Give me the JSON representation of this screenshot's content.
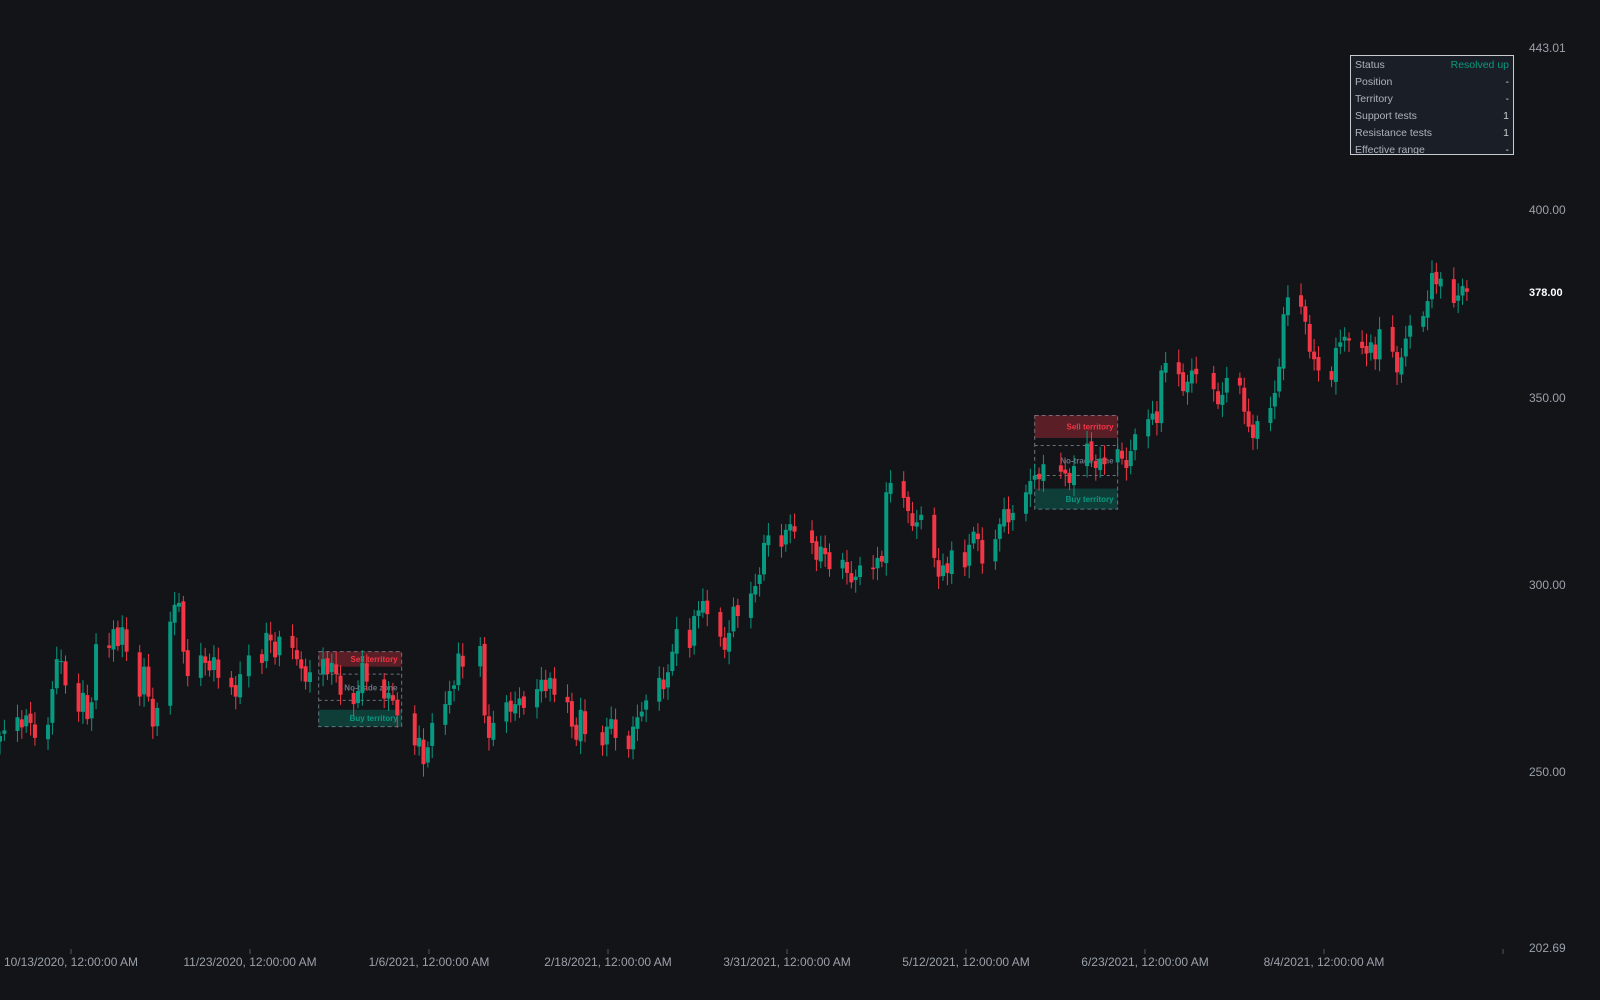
{
  "colors": {
    "background": "#131418",
    "up": "#089981",
    "down": "#f23645",
    "text": "#9aa0aa"
  },
  "price_axis": {
    "labels": [
      "443.01",
      "400.00",
      "378.00",
      "350.00",
      "300.00",
      "250.00",
      "202.69"
    ],
    "current": "378.00"
  },
  "time_axis": {
    "labels": [
      "10/13/2020, 12:00:00 AM",
      "11/23/2020, 12:00:00 AM",
      "1/6/2021, 12:00:00 AM",
      "2/18/2021, 12:00:00 AM",
      "3/31/2021, 12:00:00 AM",
      "5/12/2021, 12:00:00 AM",
      "6/23/2021, 12:00:00 AM",
      "8/4/2021, 12:00:00 AM"
    ]
  },
  "status_panel": {
    "rows": [
      {
        "label": "Status",
        "value": "Resolved up"
      },
      {
        "label": "Position",
        "value": "-"
      },
      {
        "label": "Territory",
        "value": "-"
      },
      {
        "label": "Support tests",
        "value": "1"
      },
      {
        "label": "Resistance tests",
        "value": "1"
      },
      {
        "label": "Effective range",
        "value": "-"
      }
    ]
  },
  "chart_data": {
    "type": "candlestick",
    "ylim": [
      202.69,
      443.01
    ],
    "xlim": [
      "2020-10-01",
      "2021-09-05"
    ],
    "last_price": 378.0,
    "zones": [
      {
        "x_start": "2020-12-13",
        "x_end": "2021-01-01",
        "sell_territory": [
          278.0,
          282.0
        ],
        "no_trade_zone": [
          269.0,
          276.0
        ],
        "buy_territory": [
          262.0,
          266.5
        ],
        "labels": {
          "sell": "Sell territory",
          "no_trade": "No-trade zone",
          "buy": "Buy territory"
        }
      },
      {
        "x_start": "2021-05-26",
        "x_end": "2021-06-14",
        "sell_territory": [
          339.0,
          345.0
        ],
        "no_trade_zone": [
          329.0,
          337.0
        ],
        "buy_territory": [
          320.0,
          325.5
        ],
        "labels": {
          "sell": "Sell territory",
          "no_trade": "No-trade zone",
          "buy": "Buy territory"
        }
      }
    ],
    "candles_daily_close": [
      [
        "2020-10-01",
        259.5
      ],
      [
        "2020-10-02",
        261.0
      ],
      [
        "2020-10-05",
        264.5
      ],
      [
        "2020-10-06",
        261.8
      ],
      [
        "2020-10-07",
        265.0
      ],
      [
        "2020-10-08",
        263.0
      ],
      [
        "2020-10-09",
        259.0
      ],
      [
        "2020-10-12",
        262.5
      ],
      [
        "2020-10-13",
        272.0
      ],
      [
        "2020-10-14",
        280.0
      ],
      [
        "2020-10-15",
        279.5
      ],
      [
        "2020-10-16",
        273.0
      ],
      [
        "2020-10-19",
        266.0
      ],
      [
        "2020-10-20",
        271.0
      ],
      [
        "2020-10-21",
        264.0
      ],
      [
        "2020-10-22",
        268.5
      ],
      [
        "2020-10-23",
        284.0
      ],
      [
        "2020-10-26",
        283.0
      ],
      [
        "2020-10-27",
        288.0
      ],
      [
        "2020-10-28",
        283.5
      ],
      [
        "2020-10-29",
        288.5
      ],
      [
        "2020-10-30",
        282.0
      ],
      [
        "2020-11-02",
        270.0
      ],
      [
        "2020-11-03",
        278.0
      ],
      [
        "2020-11-04",
        270.0
      ],
      [
        "2020-11-05",
        262.0
      ],
      [
        "2020-11-06",
        267.0
      ],
      [
        "2020-11-09",
        290.0
      ],
      [
        "2020-11-10",
        294.5
      ],
      [
        "2020-11-11",
        295.0
      ],
      [
        "2020-11-12",
        282.0
      ],
      [
        "2020-11-13",
        275.5
      ],
      [
        "2020-11-16",
        281.0
      ],
      [
        "2020-11-17",
        279.0
      ],
      [
        "2020-11-18",
        277.0
      ],
      [
        "2020-11-19",
        280.5
      ],
      [
        "2020-11-20",
        275.0
      ],
      [
        "2020-11-23",
        272.5
      ],
      [
        "2020-11-24",
        270.0
      ],
      [
        "2020-11-25",
        276.0
      ],
      [
        "2020-11-27",
        281.0
      ],
      [
        "2020-11-30",
        279.0
      ],
      [
        "2020-12-01",
        287.0
      ],
      [
        "2020-12-02",
        285.0
      ],
      [
        "2020-12-03",
        280.5
      ],
      [
        "2020-12-04",
        286.0
      ],
      [
        "2020-12-07",
        283.0
      ],
      [
        "2020-12-08",
        280.0
      ],
      [
        "2020-12-09",
        277.5
      ],
      [
        "2020-12-10",
        274.0
      ],
      [
        "2020-12-11",
        276.5
      ],
      [
        "2020-12-14",
        280.0
      ],
      [
        "2020-12-15",
        276.0
      ],
      [
        "2020-12-16",
        279.0
      ],
      [
        "2020-12-17",
        276.0
      ],
      [
        "2020-12-18",
        270.5
      ],
      [
        "2020-12-21",
        268.0
      ],
      [
        "2020-12-22",
        271.5
      ],
      [
        "2020-12-23",
        279.0
      ],
      [
        "2020-12-24",
        274.0
      ],
      [
        "2020-12-28",
        269.5
      ],
      [
        "2020-12-29",
        271.0
      ],
      [
        "2020-12-30",
        269.0
      ],
      [
        "2020-12-31",
        265.0
      ],
      [
        "2021-01-04",
        257.0
      ],
      [
        "2021-01-05",
        259.0
      ],
      [
        "2021-01-06",
        252.0
      ],
      [
        "2021-01-07",
        256.5
      ],
      [
        "2021-01-08",
        263.0
      ],
      [
        "2021-01-11",
        268.0
      ],
      [
        "2021-01-12",
        271.5
      ],
      [
        "2021-01-13",
        273.0
      ],
      [
        "2021-01-14",
        281.5
      ],
      [
        "2021-01-15",
        278.0
      ],
      [
        "2021-01-19",
        283.5
      ],
      [
        "2021-01-20",
        265.0
      ],
      [
        "2021-01-21",
        259.0
      ],
      [
        "2021-01-22",
        263.0
      ],
      [
        "2021-01-25",
        268.5
      ],
      [
        "2021-01-26",
        266.0
      ],
      [
        "2021-01-27",
        268.0
      ],
      [
        "2021-01-28",
        269.5
      ],
      [
        "2021-01-29",
        267.0
      ],
      [
        "2021-02-01",
        272.0
      ],
      [
        "2021-02-02",
        274.5
      ],
      [
        "2021-02-03",
        271.5
      ],
      [
        "2021-02-04",
        275.0
      ],
      [
        "2021-02-05",
        270.5
      ],
      [
        "2021-02-08",
        268.5
      ],
      [
        "2021-02-09",
        262.0
      ],
      [
        "2021-02-10",
        258.5
      ],
      [
        "2021-02-11",
        266.5
      ],
      [
        "2021-02-12",
        260.0
      ],
      [
        "2021-02-16",
        257.0
      ],
      [
        "2021-02-17",
        262.0
      ],
      [
        "2021-02-18",
        264.0
      ],
      [
        "2021-02-19",
        259.0
      ],
      [
        "2021-02-22",
        256.0
      ],
      [
        "2021-02-23",
        262.0
      ],
      [
        "2021-02-24",
        264.5
      ],
      [
        "2021-02-25",
        266.0
      ],
      [
        "2021-02-26",
        269.0
      ],
      [
        "2021-03-01",
        275.0
      ],
      [
        "2021-03-02",
        272.0
      ],
      [
        "2021-03-03",
        276.5
      ],
      [
        "2021-03-04",
        282.0
      ],
      [
        "2021-03-05",
        288.0
      ],
      [
        "2021-03-08",
        283.0
      ],
      [
        "2021-03-09",
        291.5
      ],
      [
        "2021-03-10",
        293.0
      ],
      [
        "2021-03-11",
        295.5
      ],
      [
        "2021-03-12",
        292.0
      ],
      [
        "2021-03-15",
        286.0
      ],
      [
        "2021-03-16",
        282.5
      ],
      [
        "2021-03-17",
        287.0
      ],
      [
        "2021-03-18",
        294.0
      ],
      [
        "2021-03-19",
        291.5
      ],
      [
        "2021-03-22",
        297.5
      ],
      [
        "2021-03-23",
        299.5
      ],
      [
        "2021-03-24",
        302.5
      ],
      [
        "2021-03-25",
        311.0
      ],
      [
        "2021-03-26",
        313.0
      ],
      [
        "2021-03-29",
        310.0
      ],
      [
        "2021-03-30",
        314.5
      ],
      [
        "2021-03-31",
        316.0
      ],
      [
        "2021-04-01",
        314.0
      ],
      [
        "2021-04-05",
        311.0
      ],
      [
        "2021-04-06",
        306.5
      ],
      [
        "2021-04-07",
        310.0
      ],
      [
        "2021-04-08",
        308.0
      ],
      [
        "2021-04-09",
        304.0
      ],
      [
        "2021-04-12",
        306.5
      ],
      [
        "2021-04-13",
        303.0
      ],
      [
        "2021-04-14",
        300.5
      ],
      [
        "2021-04-15",
        302.0
      ],
      [
        "2021-04-16",
        305.0
      ],
      [
        "2021-04-19",
        304.0
      ],
      [
        "2021-04-20",
        307.0
      ],
      [
        "2021-04-21",
        306.0
      ],
      [
        "2021-04-22",
        324.5
      ],
      [
        "2021-04-23",
        327.0
      ],
      [
        "2021-04-26",
        323.0
      ],
      [
        "2021-04-27",
        319.5
      ],
      [
        "2021-04-28",
        315.5
      ],
      [
        "2021-04-29",
        316.5
      ],
      [
        "2021-04-30",
        318.5
      ],
      [
        "2021-05-03",
        307.0
      ],
      [
        "2021-05-04",
        302.0
      ],
      [
        "2021-05-05",
        305.0
      ],
      [
        "2021-05-06",
        303.0
      ],
      [
        "2021-05-07",
        309.0
      ],
      [
        "2021-05-10",
        304.5
      ],
      [
        "2021-05-11",
        310.5
      ],
      [
        "2021-05-12",
        314.0
      ],
      [
        "2021-05-13",
        312.0
      ],
      [
        "2021-05-14",
        305.5
      ],
      [
        "2021-05-17",
        312.0
      ],
      [
        "2021-05-18",
        316.0
      ],
      [
        "2021-05-19",
        320.0
      ],
      [
        "2021-05-20",
        316.5
      ],
      [
        "2021-05-21",
        319.0
      ],
      [
        "2021-05-24",
        324.5
      ],
      [
        "2021-05-25",
        327.5
      ],
      [
        "2021-05-26",
        329.0
      ],
      [
        "2021-05-27",
        328.0
      ],
      [
        "2021-05-28",
        332.0
      ],
      [
        "2021-06-01",
        330.0
      ],
      [
        "2021-06-02",
        329.5
      ],
      [
        "2021-06-03",
        327.0
      ],
      [
        "2021-06-04",
        331.5
      ],
      [
        "2021-06-07",
        337.5
      ],
      [
        "2021-06-08",
        333.0
      ],
      [
        "2021-06-09",
        331.0
      ],
      [
        "2021-06-10",
        333.5
      ],
      [
        "2021-06-11",
        332.0
      ],
      [
        "2021-06-14",
        336.0
      ],
      [
        "2021-06-15",
        333.5
      ],
      [
        "2021-06-16",
        331.0
      ],
      [
        "2021-06-17",
        335.5
      ],
      [
        "2021-06-18",
        340.0
      ],
      [
        "2021-06-21",
        344.0
      ],
      [
        "2021-06-22",
        345.5
      ],
      [
        "2021-06-23",
        343.0
      ],
      [
        "2021-06-24",
        357.0
      ],
      [
        "2021-06-25",
        359.0
      ],
      [
        "2021-06-28",
        356.0
      ],
      [
        "2021-06-29",
        351.5
      ],
      [
        "2021-06-30",
        354.0
      ],
      [
        "2021-07-01",
        357.0
      ],
      [
        "2021-07-02",
        356.0
      ],
      [
        "2021-07-06",
        352.0
      ],
      [
        "2021-07-07",
        348.0
      ],
      [
        "2021-07-08",
        350.5
      ],
      [
        "2021-07-09",
        355.0
      ],
      [
        "2021-07-12",
        353.0
      ],
      [
        "2021-07-13",
        346.0
      ],
      [
        "2021-07-14",
        342.0
      ],
      [
        "2021-07-15",
        339.0
      ],
      [
        "2021-07-16",
        343.5
      ],
      [
        "2021-07-19",
        347.0
      ],
      [
        "2021-07-20",
        351.0
      ],
      [
        "2021-07-21",
        358.0
      ],
      [
        "2021-07-22",
        372.0
      ],
      [
        "2021-07-23",
        376.5
      ],
      [
        "2021-07-26",
        374.0
      ],
      [
        "2021-07-27",
        370.0
      ],
      [
        "2021-07-28",
        362.0
      ],
      [
        "2021-07-29",
        360.0
      ],
      [
        "2021-07-30",
        357.0
      ],
      [
        "2021-08-02",
        354.5
      ],
      [
        "2021-08-03",
        363.0
      ],
      [
        "2021-08-04",
        364.5
      ],
      [
        "2021-08-05",
        366.0
      ],
      [
        "2021-08-06",
        365.0
      ],
      [
        "2021-08-09",
        363.0
      ],
      [
        "2021-08-10",
        361.5
      ],
      [
        "2021-08-11",
        364.5
      ],
      [
        "2021-08-12",
        360.0
      ],
      [
        "2021-08-13",
        368.0
      ],
      [
        "2021-08-16",
        362.0
      ],
      [
        "2021-08-17",
        356.5
      ],
      [
        "2021-08-18",
        360.5
      ],
      [
        "2021-08-19",
        365.5
      ],
      [
        "2021-08-20",
        369.0
      ],
      [
        "2021-08-23",
        371.5
      ],
      [
        "2021-08-24",
        375.5
      ],
      [
        "2021-08-25",
        383.0
      ],
      [
        "2021-08-26",
        380.0
      ],
      [
        "2021-08-27",
        381.5
      ],
      [
        "2021-08-30",
        375.0
      ],
      [
        "2021-08-31",
        377.0
      ],
      [
        "2021-09-01",
        379.5
      ],
      [
        "2021-09-02",
        378.0
      ]
    ]
  }
}
